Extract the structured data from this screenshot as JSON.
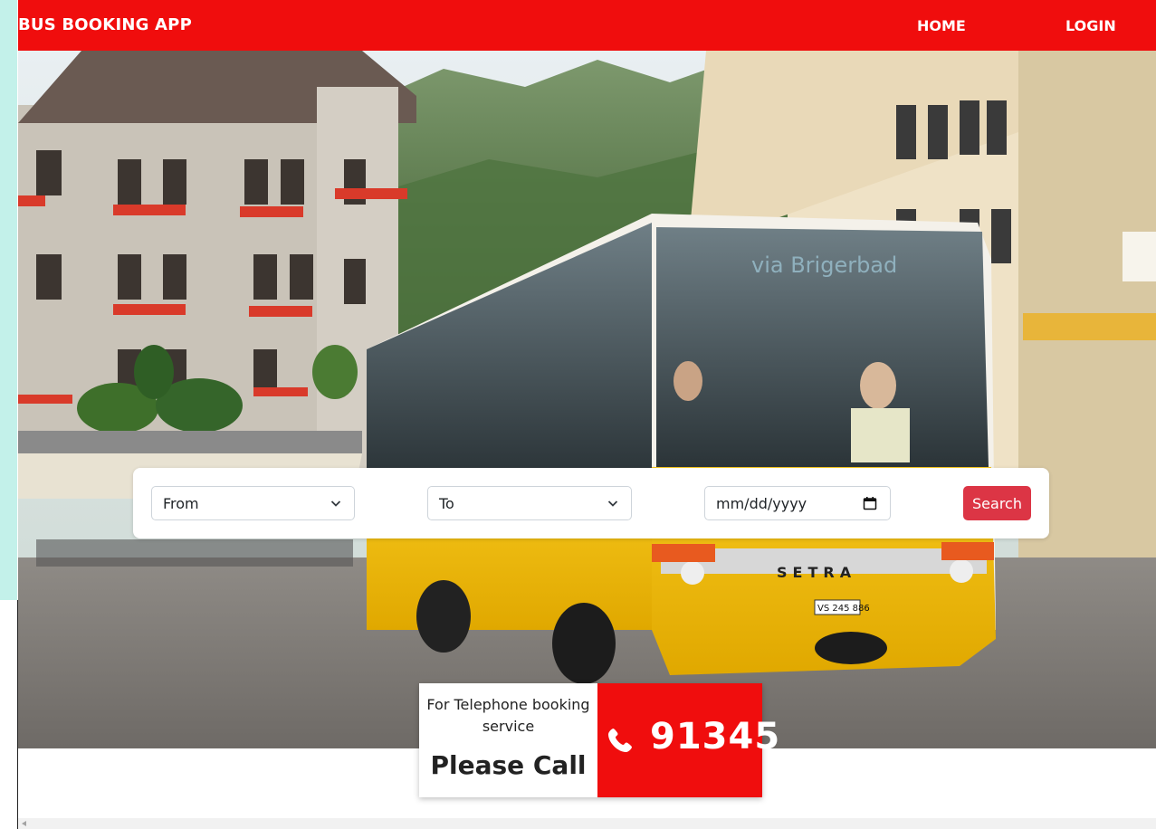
{
  "navbar": {
    "brand": "BUS BOOKING APP",
    "home": "HOME",
    "login": "LOGIN"
  },
  "search": {
    "from_label": "From",
    "to_label": "To",
    "date_placeholder": "mm/dd/yyyy",
    "button_label": "Search"
  },
  "hero": {
    "bus_destination_sign": "via Brigerbad",
    "bus_brand": "SETRA",
    "license_plate": "VS 245 886"
  },
  "call": {
    "note": "For Telephone booking service",
    "please": "Please Call",
    "number": "91345"
  },
  "colors": {
    "brand_red": "#f00d0d",
    "search_red": "#dc3545",
    "accent_mint": "#c3f1ea"
  },
  "icons": [
    "chevron-down-icon",
    "calendar-icon",
    "phone-icon"
  ]
}
